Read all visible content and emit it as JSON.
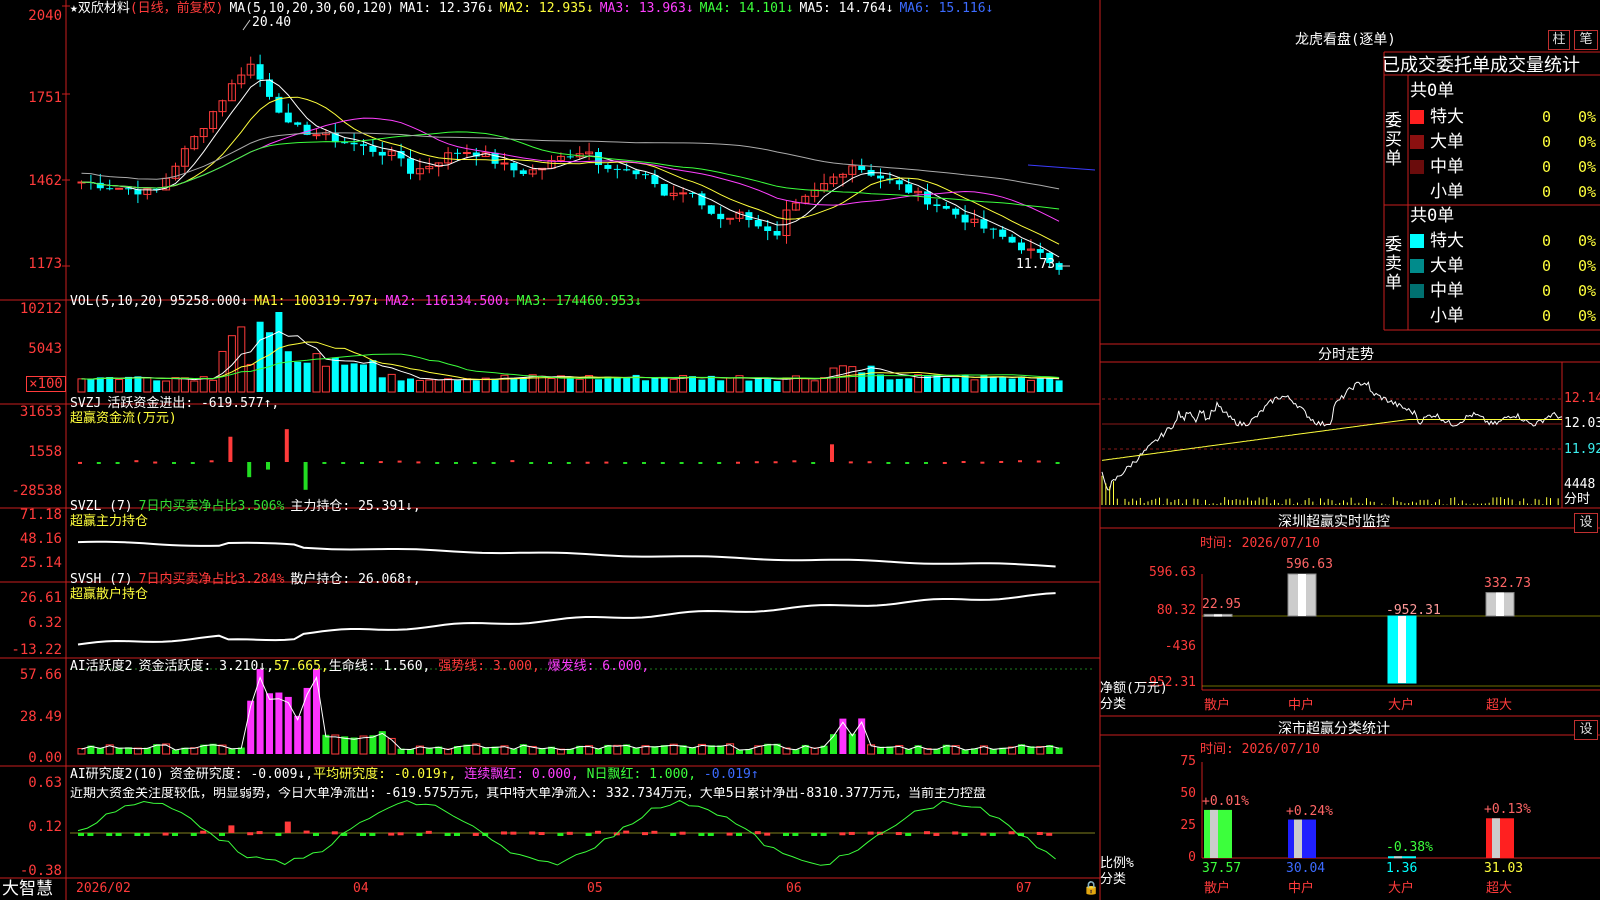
{
  "stock": {
    "title": "★双欣材料",
    "period": "(日线，前复权)",
    "ma_line": [
      "MA(5,10,20,30,60,120)",
      "MA1: 12.376↓",
      "MA2: 12.935↓",
      "MA3: 13.963↓",
      "MA4: 14.101↓",
      "MA5: 14.764↓",
      "MA6: 15.116↓"
    ],
    "high_label": "20.40",
    "low_label": "11.73",
    "axis": [
      "2040",
      "1751",
      "1462",
      "1173"
    ]
  },
  "volume": {
    "line": [
      "VOL(5,10,20)",
      "95258.000↓",
      "MA1: 100319.797↓",
      "MA2: 116134.500↓",
      "MA3: 174460.953↓"
    ],
    "axis": [
      "10212",
      "5043",
      "×100"
    ]
  },
  "svzj": {
    "line": [
      "SVZJ",
      "活跃资金进出: -619.577↑,"
    ],
    "title": "超赢资金流(万元)",
    "axis": [
      "31653",
      "1558",
      "-28538"
    ]
  },
  "svzl": {
    "line": [
      "SVZL (7)",
      "7日内买卖净占比3.506%",
      "主力持仓: 25.391↓,"
    ],
    "title": "超赢主力持仓",
    "axis": [
      "71.18",
      "48.16",
      "25.14"
    ]
  },
  "svsh": {
    "line": [
      "SVSH (7)",
      "7日内买卖净占比3.284%",
      "散户持仓: 26.068↑,"
    ],
    "title": "超赢散户持仓",
    "axis": [
      "26.61",
      "6.32",
      "-13.22"
    ]
  },
  "ai_active": {
    "line": [
      "AI活跃度2",
      "资金活跃度: 3.210↓,",
      "57.665,",
      "生命线: 1.560,",
      "强势线: 3.000,",
      "爆发线: 6.000,"
    ],
    "axis": [
      "57.66",
      "28.49",
      "0.00"
    ]
  },
  "ai_research": {
    "line": [
      "AI研究度2(10)",
      "资金研究度: -0.009↓,",
      "平均研究度: -0.019↑,",
      "连续飘红: 0.000,",
      "N日飘红: 1.000,",
      "-0.019↑"
    ],
    "comment": "近期大资金关注度较低，明显弱势，今日大单净流出: -619.575万元，其中特大单净流入: 332.734万元，大单5日累计净出-8310.377万元，当前主力控盘",
    "axis": [
      "0.63",
      "0.12",
      "-0.38"
    ]
  },
  "bottom": {
    "brand": "大智慧",
    "dates": [
      "2026/02",
      "04",
      "05",
      "06",
      "07"
    ]
  },
  "longhu": {
    "title": "龙虎看盘(逐单)",
    "btn_bar": "柱",
    "btn_pen": "笔",
    "subtitle": "已成交委托单成交量统计",
    "buy": {
      "label": "委买单",
      "total": "共0单",
      "rows": [
        {
          "name": "特大",
          "count": "0",
          "pct": "0%",
          "color": "#ff2020"
        },
        {
          "name": "大单",
          "count": "0",
          "pct": "0%",
          "color": "#8b1010"
        },
        {
          "name": "中单",
          "count": "0",
          "pct": "0%",
          "color": "#6a0c0c"
        },
        {
          "name": "小单",
          "count": "0",
          "pct": "0%",
          "color": ""
        }
      ]
    },
    "sell": {
      "label": "委卖单",
      "total": "共0单",
      "rows": [
        {
          "name": "特大",
          "count": "0",
          "pct": "0%",
          "color": "#00ffff"
        },
        {
          "name": "大单",
          "count": "0",
          "pct": "0%",
          "color": "#008b8b"
        },
        {
          "name": "中单",
          "count": "0",
          "pct": "0%",
          "color": "#007070"
        },
        {
          "name": "小单",
          "count": "0",
          "pct": "0%",
          "color": ""
        }
      ]
    }
  },
  "intraday": {
    "title": "分时走势",
    "axis": [
      "12.14",
      "12.03",
      "11.92",
      "4448"
    ],
    "vol_unit": "分时"
  },
  "monitor": {
    "title": "深圳超赢实时监控",
    "btn": "设",
    "time": "时间: 2026/07/10",
    "axis": [
      "596.63",
      "80.32",
      "-436",
      "-952.31"
    ],
    "ylabel": "净额(万元)",
    "xlabel": "分类",
    "categories": [
      "散户",
      "中户",
      "大户",
      "超大"
    ],
    "values": [
      22.95,
      596.63,
      -952.31,
      332.73
    ],
    "value_labels": [
      "22.95",
      "596.63",
      "-952.31",
      "332.73"
    ]
  },
  "classify": {
    "title": "深市超赢分类统计",
    "btn": "设",
    "time": "时间: 2026/07/10",
    "axis": [
      "75",
      "50",
      "25",
      "0"
    ],
    "ylabel": "比例%",
    "xlabel": "分类",
    "categories": [
      "散户",
      "中户",
      "大户",
      "超大"
    ],
    "pct_labels": [
      "+0.01%",
      "+0.24%",
      "-0.38%",
      "+0.13%"
    ],
    "values": [
      37.57,
      30.04,
      1.36,
      31.03
    ],
    "value_labels": [
      "37.57",
      "30.04",
      "1.36",
      "31.03"
    ]
  },
  "colors": {
    "up": "#ff3b3b",
    "down": "#00ffff",
    "frame": "#c81e1e",
    "ma1": "#ffffff",
    "ma2": "#ffff3c",
    "ma3": "#ff40ff",
    "ma4": "#3cff3c",
    "ma5": "#aaaaaa",
    "ma6": "#3c3cff"
  }
}
